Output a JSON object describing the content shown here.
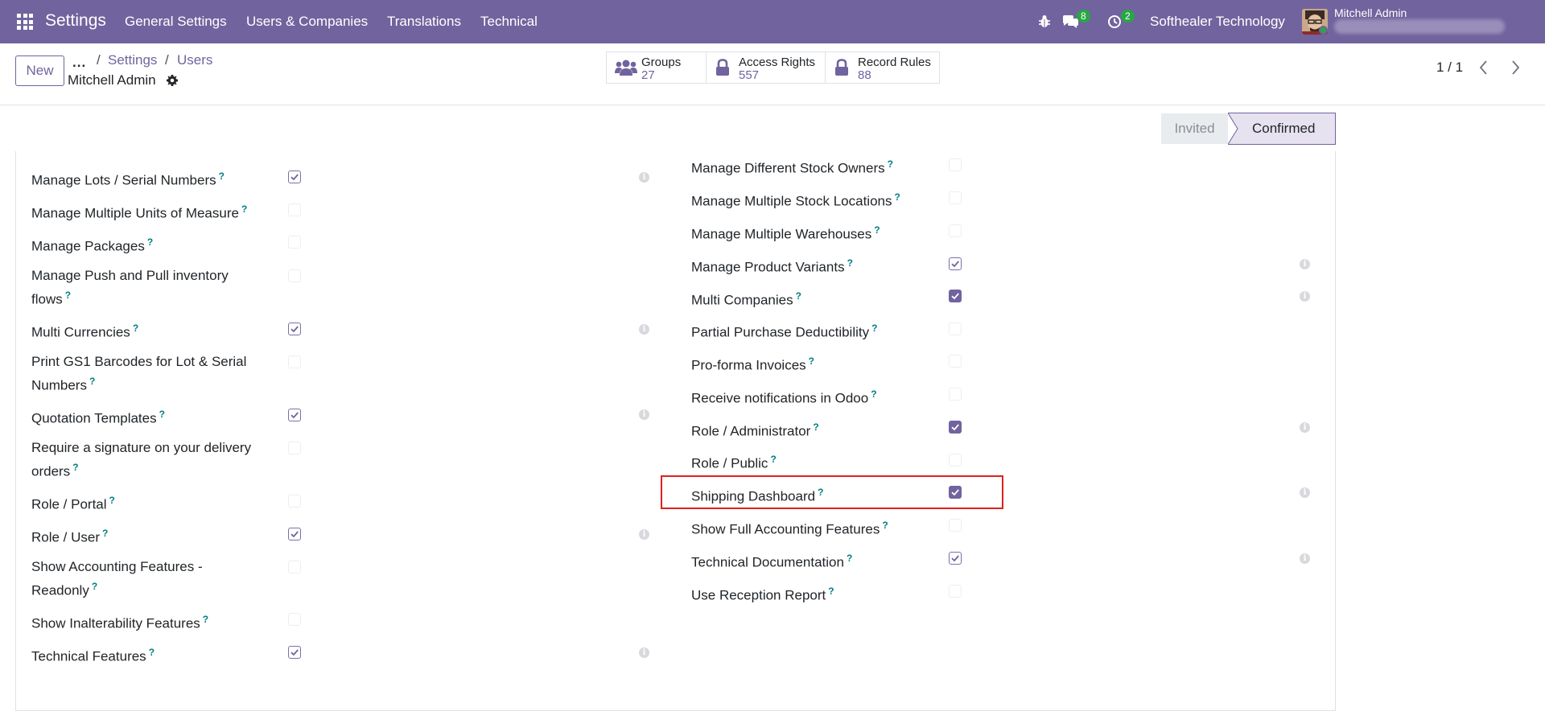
{
  "navbar": {
    "app_title": "Settings",
    "menu": [
      "General Settings",
      "Users & Companies",
      "Translations",
      "Technical"
    ],
    "messages_count": "8",
    "activities_count": "2",
    "company": "Softhealer Technology",
    "user_name": "Mitchell Admin"
  },
  "control_panel": {
    "new_label": "New",
    "actions_label": "...",
    "breadcrumb": [
      "Settings",
      "Users"
    ],
    "record_title": "Mitchell Admin",
    "stats": [
      {
        "label": "Groups",
        "value": "27",
        "icon": "users-icon"
      },
      {
        "label": "Access Rights",
        "value": "557",
        "icon": "lock-icon"
      },
      {
        "label": "Record Rules",
        "value": "88",
        "icon": "lock-icon"
      }
    ],
    "pager": "1 / 1"
  },
  "statusbar": {
    "states": [
      "Invited",
      "Confirmed"
    ],
    "active": "Confirmed"
  },
  "left_fields": [
    {
      "label": "Manage Lots / Serial Numbers",
      "checked": true
    },
    {
      "label": "Manage Multiple Units of Measure",
      "checked": false
    },
    {
      "label": "Manage Packages",
      "checked": false
    },
    {
      "label": "Manage Push and Pull inventory flows",
      "checked": false
    },
    {
      "label": "Multi Currencies",
      "checked": true
    },
    {
      "label": "Print GS1 Barcodes for Lot & Serial Numbers",
      "checked": false
    },
    {
      "label": "Quotation Templates",
      "checked": true
    },
    {
      "label": "Require a signature on your delivery orders",
      "checked": false
    },
    {
      "label": "Role / Portal",
      "checked": false
    },
    {
      "label": "Role / User",
      "checked": true
    },
    {
      "label": "Show Accounting Features - Readonly",
      "checked": false
    },
    {
      "label": "Show Inalterability Features",
      "checked": false
    },
    {
      "label": "Technical Features",
      "checked": true
    }
  ],
  "right_fields": [
    {
      "label": "Manage Different Stock Owners",
      "checked": false
    },
    {
      "label": "Manage Multiple Stock Locations",
      "checked": false
    },
    {
      "label": "Manage Multiple Warehouses",
      "checked": false
    },
    {
      "label": "Manage Product Variants",
      "checked": true
    },
    {
      "label": "Multi Companies",
      "checked": true
    },
    {
      "label": "Partial Purchase Deductibility",
      "checked": false
    },
    {
      "label": "Pro-forma Invoices",
      "checked": false
    },
    {
      "label": "Receive notifications in Odoo",
      "checked": false
    },
    {
      "label": "Role / Administrator",
      "checked": true
    },
    {
      "label": "Role / Public",
      "checked": false
    },
    {
      "label": "Shipping Dashboard",
      "checked": true
    },
    {
      "label": "Show Full Accounting Features",
      "checked": false
    },
    {
      "label": "Technical Documentation",
      "checked": true
    },
    {
      "label": "Use Reception Report",
      "checked": false
    }
  ],
  "help_marker": "?",
  "colors": {
    "brand": "#71639e",
    "help": "#017e84",
    "highlight": "#e02020",
    "badge": "#28a745"
  }
}
